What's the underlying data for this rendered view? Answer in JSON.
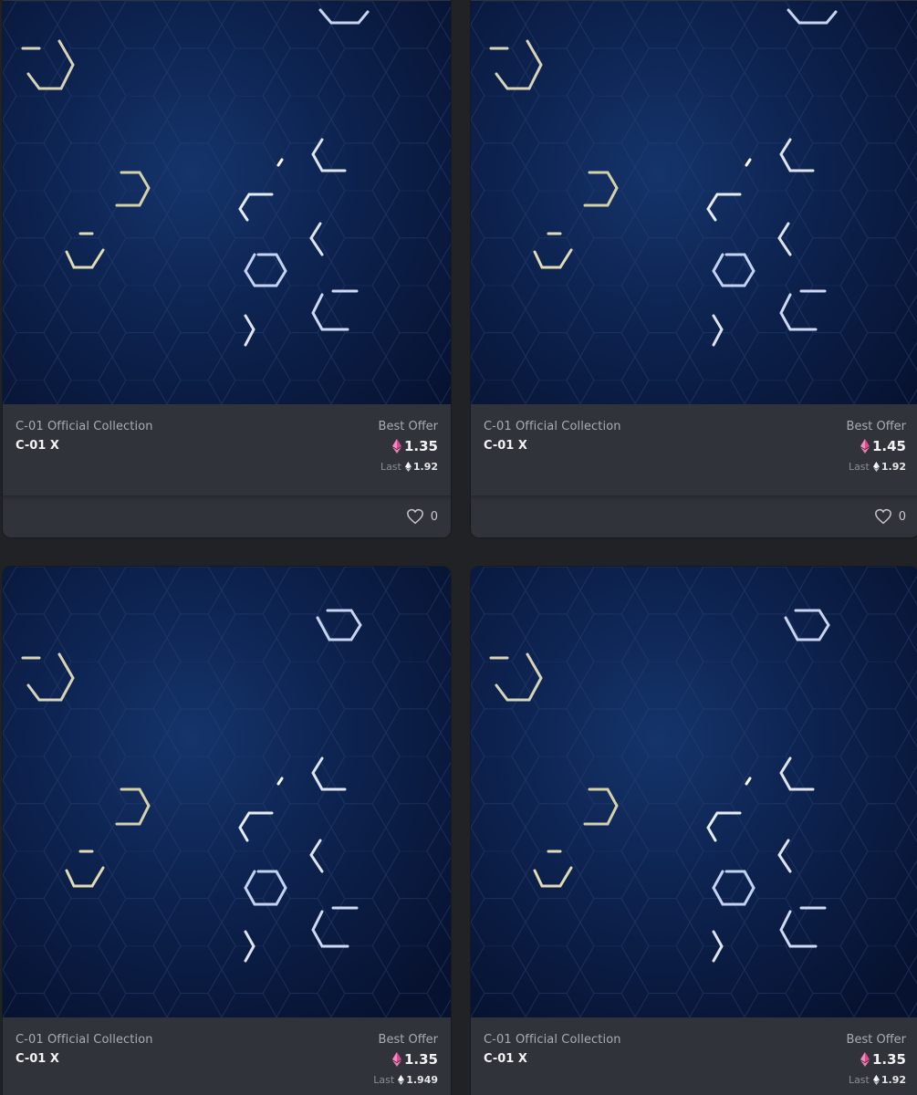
{
  "colors": {
    "page_background": "#202225",
    "card_background": "#303339",
    "art_background": "#0b1c3d",
    "eth_pink": "#e1488e",
    "heart_icon": "#c6c8cb"
  },
  "cards": [
    {
      "collection": "C-01 Official Collection",
      "name": "C-01 X",
      "offer_label": "Best Offer",
      "offer_price": "1.35",
      "last_label": "Last",
      "last_price": "1.92",
      "favorites": "0",
      "icons": [
        "nft-artwork",
        "eth-pink-icon",
        "eth-icon",
        "heart-icon"
      ]
    },
    {
      "collection": "C-01 Official Collection",
      "name": "C-01 X",
      "offer_label": "Best Offer",
      "offer_price": "1.45",
      "last_label": "Last",
      "last_price": "1.92",
      "favorites": "0",
      "icons": [
        "nft-artwork",
        "eth-pink-icon",
        "eth-icon",
        "heart-icon"
      ]
    },
    {
      "collection": "C-01 Official Collection",
      "name": "C-01 X",
      "offer_label": "Best Offer",
      "offer_price": "1.35",
      "last_label": "Last",
      "last_price": "1.949",
      "icons": [
        "nft-artwork",
        "eth-pink-icon",
        "eth-icon"
      ]
    },
    {
      "collection": "C-01 Official Collection",
      "name": "C-01 X",
      "offer_label": "Best Offer",
      "offer_price": "1.35",
      "last_label": "Last",
      "last_price": "1.92",
      "icons": [
        "nft-artwork",
        "eth-pink-icon",
        "eth-icon"
      ]
    }
  ]
}
